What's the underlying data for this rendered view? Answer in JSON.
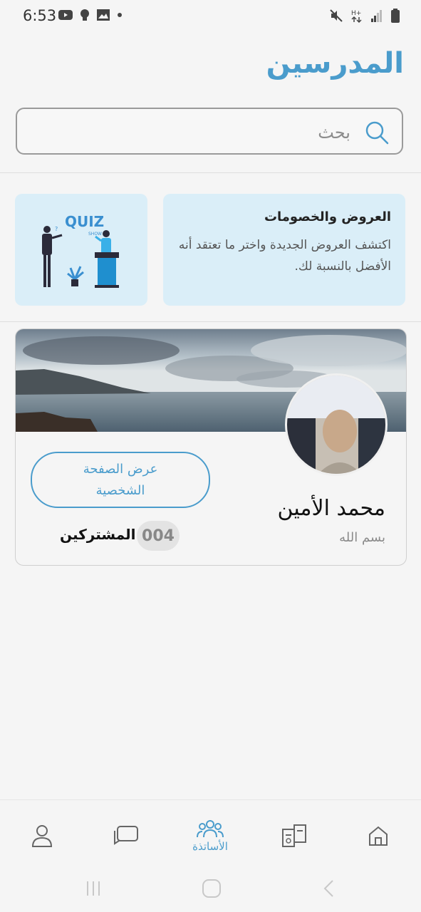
{
  "status_bar": {
    "time": "6:53",
    "left_icons": [
      "youtube-icon",
      "bulb-icon",
      "gallery-icon",
      "dot-icon"
    ],
    "right_icons": [
      "mute-icon",
      "network-hplus-icon",
      "signal-icon",
      "battery-icon"
    ]
  },
  "header": {
    "title": "المدرسين"
  },
  "search": {
    "placeholder": "بحث",
    "value": ""
  },
  "promo": {
    "title": "العروض والخصومات",
    "description": "اكتشف العروض الجديدة واختر ما تعتقد أنه الأفضل بالنسبة لك.",
    "image_text": "QUIZ",
    "image_subtext": "SHOW"
  },
  "teacher": {
    "name": "محمد الأمين",
    "tagline": "بسم الله",
    "view_profile_label": "عرض الصفحة الشخصية",
    "subscribers_count": "004",
    "subscribers_label": "المشتركين"
  },
  "bottom_nav": {
    "items": [
      {
        "icon": "profile-icon",
        "label": "",
        "active": false
      },
      {
        "icon": "chat-icon",
        "label": "",
        "active": false
      },
      {
        "icon": "teachers-icon",
        "label": "الأساتذة",
        "active": true
      },
      {
        "icon": "exams-icon",
        "label": "",
        "active": false
      },
      {
        "icon": "home-icon",
        "label": "",
        "active": false
      }
    ]
  },
  "colors": {
    "accent": "#4a9ccc",
    "card_bg": "#daeef8",
    "background": "#f5f5f5"
  }
}
